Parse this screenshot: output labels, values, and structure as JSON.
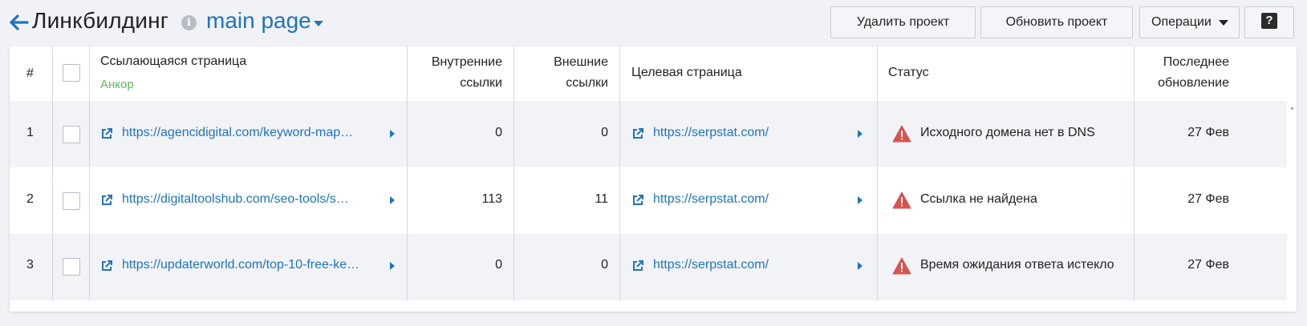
{
  "header": {
    "title": "Линкбилдинг",
    "project": "main page",
    "buttons": {
      "delete": "Удалить проект",
      "refresh": "Обновить проект",
      "operations": "Операции",
      "help": "?"
    }
  },
  "table": {
    "columns": {
      "num": "#",
      "referring": "Ссылающаяся страница",
      "anchor": "Анкор",
      "internal": [
        "Внутренние",
        "ссылки"
      ],
      "external": [
        "Внешние",
        "ссылки"
      ],
      "target": "Целевая страница",
      "status": "Статус",
      "updated": [
        "Последнее",
        "обновление"
      ]
    },
    "rows": [
      {
        "num": "1",
        "referring": "https://agencidigital.com/keyword-map…",
        "internal": "0",
        "external": "0",
        "target": "https://serpstat.com/",
        "status": "Исходного домена нет в DNS",
        "updated": "27 Фев"
      },
      {
        "num": "2",
        "referring": "https://digitaltoolshub.com/seo-tools/s…",
        "internal": "113",
        "external": "11",
        "target": "https://serpstat.com/",
        "status": "Ссылка не найдена",
        "updated": "27 Фев"
      },
      {
        "num": "3",
        "referring": "https://updaterworld.com/top-10-free-ke…",
        "internal": "0",
        "external": "0",
        "target": "https://serpstat.com/",
        "status": "Время ожидания ответа истекло",
        "updated": "27 Фев"
      }
    ]
  },
  "colors": {
    "link": "#1e73be",
    "anchor": "#5cb85c",
    "warning": "#d9534f",
    "row_shade": "#f2f3f7"
  }
}
